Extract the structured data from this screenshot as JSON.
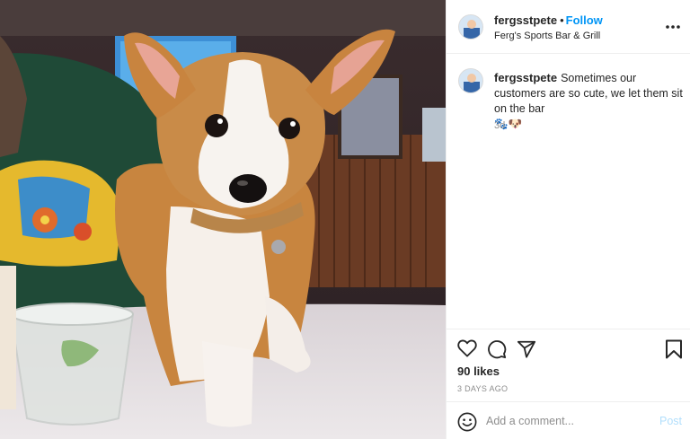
{
  "header": {
    "username": "fergsstpete",
    "separator": "•",
    "follow_label": "Follow",
    "location": "Ferg's Sports Bar & Grill",
    "more_icon": "more-horizontal-icon"
  },
  "caption": {
    "username": "fergsstpete",
    "text": "Sometimes our customers are so cute, we let them sit on the bar",
    "emojis": "🐾🐶",
    "time_ago": "3d"
  },
  "actions": {
    "like_icon": "heart-icon",
    "comment_icon": "comment-icon",
    "share_icon": "share-icon",
    "save_icon": "bookmark-icon"
  },
  "likes": "90 likes",
  "posted": "3 DAYS AGO",
  "comment_box": {
    "emoji_icon": "smiley-icon",
    "placeholder": "Add a comment...",
    "post_label": "Post"
  },
  "colors": {
    "link_blue": "#0095f6",
    "post_disabled": "#b2dffc",
    "secondary_text": "#8e8e8e",
    "border": "#efefef"
  }
}
